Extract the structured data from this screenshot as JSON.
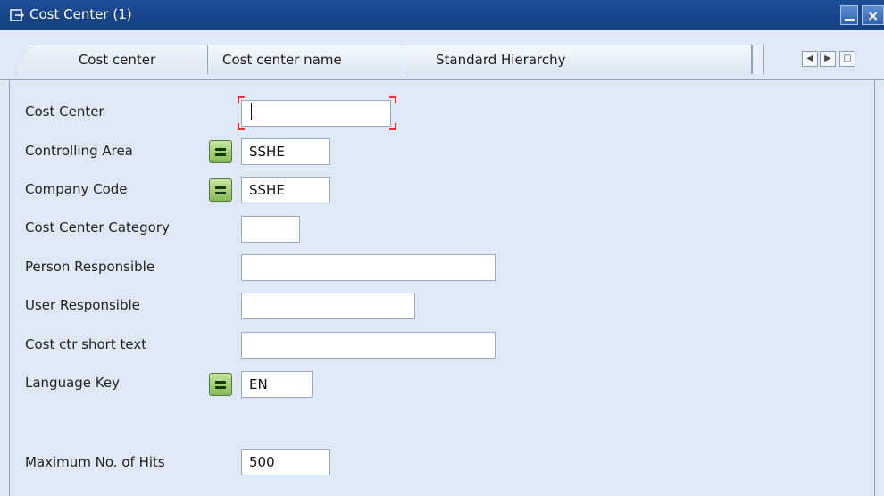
{
  "window": {
    "title": "Cost Center (1)",
    "icon": "window-icon"
  },
  "tabs": [
    {
      "label": "Cost center",
      "active": true
    },
    {
      "label": "Cost center name",
      "active": false
    },
    {
      "label": "Standard Hierarchy",
      "active": false
    }
  ],
  "form": {
    "cost_center": {
      "label": "Cost Center",
      "value": ""
    },
    "controlling_area": {
      "label": "Controlling Area",
      "value": "SSHE",
      "operator_icon": "equals-icon"
    },
    "company_code": {
      "label": "Company Code",
      "value": "SSHE",
      "operator_icon": "equals-icon"
    },
    "cost_center_category": {
      "label": "Cost Center Category",
      "value": ""
    },
    "person_responsible": {
      "label": "Person Responsible",
      "value": ""
    },
    "user_responsible": {
      "label": "User Responsible",
      "value": ""
    },
    "cost_ctr_short_text": {
      "label": "Cost ctr short text",
      "value": ""
    },
    "language_key": {
      "label": "Language Key",
      "value": "EN",
      "operator_icon": "equals-icon"
    },
    "maximum_hits": {
      "label": "Maximum No. of Hits",
      "value": "500"
    }
  },
  "colors": {
    "title_bar": "#143f80",
    "panel_bg": "#dfe9f5",
    "operator_button": "#86bb55",
    "focus_marker": "#e23232"
  }
}
